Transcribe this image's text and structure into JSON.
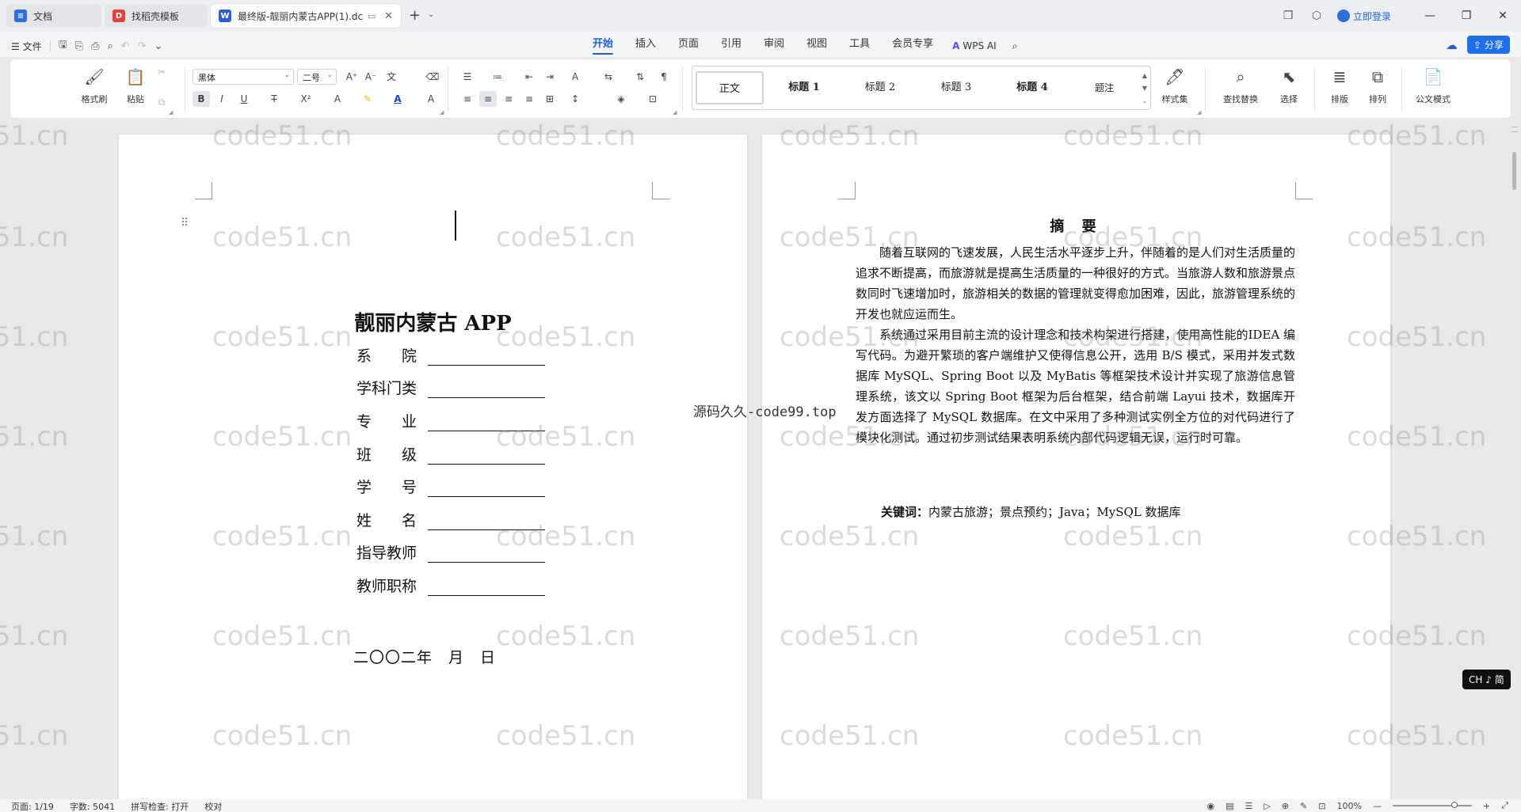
{
  "titlebar": {
    "tabs": [
      {
        "label": "文档",
        "icon": "doc-icon",
        "color": "#2f6de0"
      },
      {
        "label": "找稻壳模板",
        "icon": "docer-icon",
        "color": "#e0413a"
      },
      {
        "label": "最终版-靓丽内蒙古APP(1).dc",
        "icon": "word-icon",
        "color": "#2f5bd6"
      }
    ],
    "login_label": "立即登录"
  },
  "menubar": {
    "file_label": "文件",
    "tabs": [
      "开始",
      "插入",
      "页面",
      "引用",
      "审阅",
      "视图",
      "工具",
      "会员专享"
    ],
    "active_tab": "开始",
    "wps_ai_label": "WPS AI",
    "share_label": "分享"
  },
  "ribbon": {
    "format_painter": "格式刷",
    "paste": "粘贴",
    "font_name": "黑体",
    "font_size": "二号",
    "styles": [
      "正文",
      "标题 1",
      "标题 2",
      "标题 3",
      "标题 4",
      "题注"
    ],
    "style_set": "样式集",
    "find_replace": "查找替换",
    "select": "选择",
    "layout": "排版",
    "arrange": "排列",
    "official_mode": "公文模式"
  },
  "cover": {
    "title": "靓丽内蒙古 APP",
    "fields": [
      "系　　院",
      "学科门类",
      "专　　业",
      "班　　级",
      "学　　号",
      "姓　　名",
      "指导教师",
      "教师职称"
    ],
    "date": "二〇〇二年　月　日"
  },
  "abstract": {
    "heading": "摘 要",
    "p1": "随着互联网的飞速发展，人民生活水平逐步上升，伴随着的是人们对生活质量的追求不断提高，而旅游就是提高生活质量的一种很好的方式。当旅游人数和旅游景点数同时飞速增加时，旅游相关的数据的管理就变得愈加困难，因此，旅游管理系统的开发也就应运而生。",
    "p2": "系统通过采用目前主流的设计理念和技术构架进行搭建，使用高性能的IDEA 编写代码。为避开繁琐的客户端维护又使得信息公开，选用 B/S 模式，采用并发式数据库 MySQL、Spring Boot 以及 MyBatis 等框架技术设计并实现了旅游信息管理系统，该文以 Spring Boot 框架为后台框架，结合前端 Layui 技术，数据库开发方面选择了 MySQL 数据库。在文中采用了多种测试实例全方位的对代码进行了模块化测试。通过初步测试结果表明系统内部代码逻辑无误，运行时可靠。",
    "keywords_label": "关键词：",
    "keywords": "内蒙古旅游；景点预约；Java；MySQL 数据库"
  },
  "overlay_text": "源码久久-code99.top",
  "watermark_text": "code51.cn",
  "ime_label": "CH ♪ 简",
  "statusbar": {
    "page": "页面: 1/19",
    "words": "字数: 5041",
    "spellcheck": "拼写检查: 打开",
    "proofread": "校对",
    "zoom": "100%"
  }
}
